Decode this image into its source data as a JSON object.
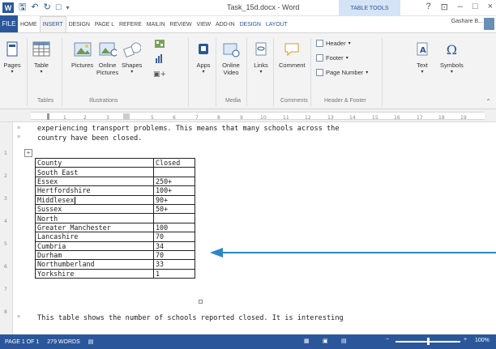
{
  "titlebar": {
    "logo": "W",
    "doc_title": "Task_15d.docx - Word",
    "table_tools": "TABLE TOOLS",
    "help": "?",
    "restore": "⊡",
    "minimize": "–",
    "maximize": "□",
    "close": "×"
  },
  "tabs": {
    "file": "FILE",
    "items": [
      "HOME",
      "INSERT",
      "DESIGN",
      "PAGE L",
      "REFERE",
      "MAILIN",
      "REVIEW",
      "VIEW",
      "ADD-IN",
      "DESIGN",
      "LAYOUT"
    ],
    "user": "Gashare B..."
  },
  "ribbon": {
    "pages": "Pages",
    "table": "Table",
    "pictures": "Pictures",
    "online_pictures_1": "Online",
    "online_pictures_2": "Pictures",
    "shapes": "Shapes",
    "apps": "Apps",
    "online_video_1": "Online",
    "online_video_2": "Video",
    "links": "Links",
    "comment": "Comment",
    "header": "Header",
    "footer": "Footer",
    "page_number": "Page Number",
    "text": "Text",
    "symbols": "Symbols",
    "grp_tables": "Tables",
    "grp_illustrations": "Illustrations",
    "grp_media": "Media",
    "grp_comments": "Comments",
    "grp_header_footer": "Header & Footer"
  },
  "document": {
    "line1": "experiencing transport problems. This means that many schools across the",
    "line2": "country have been closed.",
    "table_header": [
      "County",
      "Closed"
    ],
    "rows": [
      [
        "South East",
        ""
      ],
      [
        "Essex",
        "250+"
      ],
      [
        "Hertfordshire",
        "100+"
      ],
      [
        "Middlesex",
        "90+"
      ],
      [
        "Sussex",
        "50+"
      ],
      [
        "North",
        ""
      ],
      [
        "Greater Manchester",
        "100"
      ],
      [
        "Lancashire",
        "70"
      ],
      [
        "Cumbria",
        "34"
      ],
      [
        "Durham",
        "70"
      ],
      [
        "Northumberland",
        "33"
      ],
      [
        "Yorkshire",
        "1"
      ]
    ],
    "line_after": "This table shows the number of schools reported closed. It is interesting"
  },
  "statusbar": {
    "page": "PAGE 1 OF 1",
    "words": "279 WORDS",
    "zoom": "100%"
  },
  "colors": {
    "accent": "#2b579a",
    "arrow": "#2e86c8"
  }
}
